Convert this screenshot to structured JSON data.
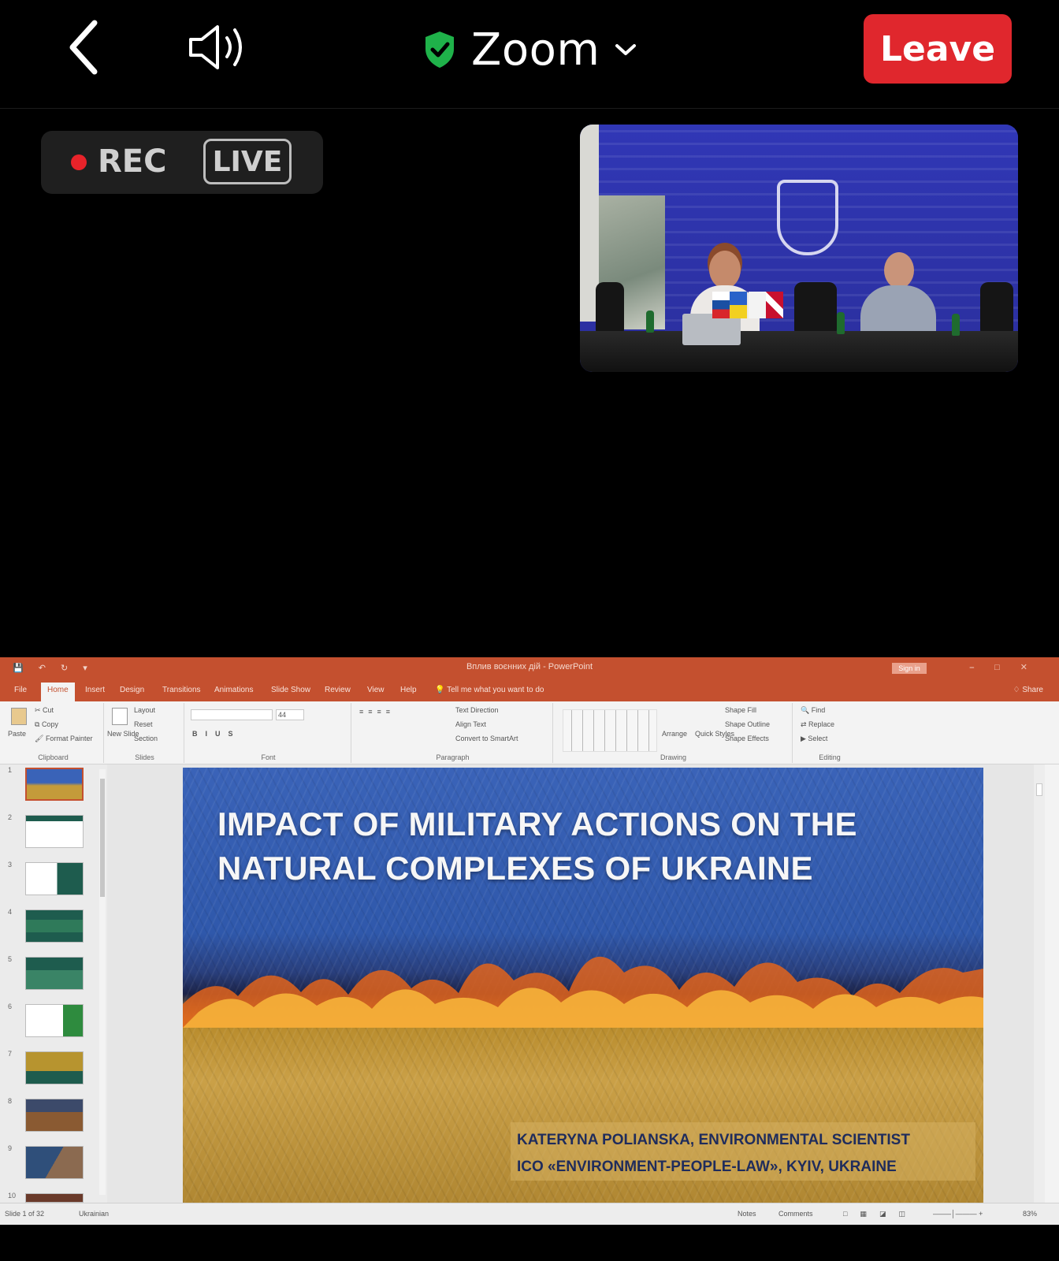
{
  "zoom": {
    "title": "Zoom",
    "leave_label": "Leave",
    "rec_label": "REC",
    "live_label": "LIVE",
    "accent_leave": "#e0272d",
    "shield_color": "#1fb24a",
    "icons": [
      "back-chevron-icon",
      "speaker-icon",
      "shield-check-icon",
      "chevron-down-icon"
    ]
  },
  "ppt": {
    "window_title": "Вплив воєнних дій - PowerPoint",
    "signin_label": "Sign in",
    "tabs": [
      "File",
      "Home",
      "Insert",
      "Design",
      "Transitions",
      "Animations",
      "Slide Show",
      "Review",
      "View",
      "Help"
    ],
    "tell_me": "Tell me what you want to do",
    "share_label": "Share",
    "ribbon": {
      "clipboard": {
        "paste": "Paste",
        "cut": "Cut",
        "copy": "Copy",
        "format_painter": "Format Painter",
        "label": "Clipboard"
      },
      "slides": {
        "new_slide": "New Slide",
        "layout": "Layout",
        "reset": "Reset",
        "section": "Section",
        "label": "Slides"
      },
      "font": {
        "size": "44",
        "label": "Font"
      },
      "paragraph": {
        "text_direction": "Text Direction",
        "align_text": "Align Text",
        "smartart": "Convert to SmartArt",
        "label": "Paragraph"
      },
      "drawing": {
        "arrange": "Arrange",
        "quick_styles": "Quick Styles",
        "shape_fill": "Shape Fill",
        "shape_outline": "Shape Outline",
        "shape_effects": "Shape Effects",
        "label": "Drawing"
      },
      "editing": {
        "find": "Find",
        "replace": "Replace",
        "select": "Select",
        "label": "Editing"
      }
    },
    "thumbnails": [
      "1",
      "2",
      "3",
      "4",
      "5",
      "6",
      "7",
      "8",
      "9",
      "10"
    ],
    "slide": {
      "title_line1": "IMPACT OF MILITARY ACTIONS ON THE",
      "title_line2": "NATURAL COMPLEXES OF UKRAINE",
      "author_line1": "KATERYNA POLIANSKA, ENVIRONMENTAL SCIENTIST",
      "author_line2": "ICO «ENVIRONMENT-PEOPLE-LAW», KYIV, UKRAINE"
    },
    "status": {
      "slide_info": "Slide 1 of 32",
      "language": "Ukrainian",
      "notes": "Notes",
      "comments": "Comments",
      "zoom": "83%"
    },
    "accent": "#c4502f"
  }
}
